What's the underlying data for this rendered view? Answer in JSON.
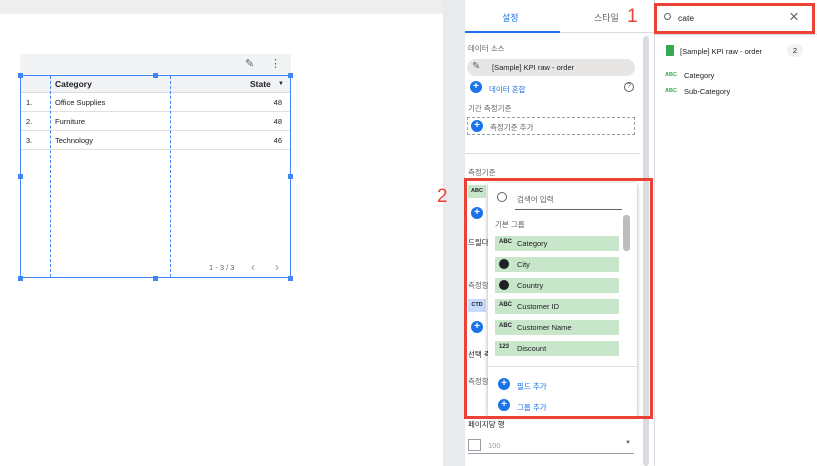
{
  "table": {
    "headers": [
      "Category",
      "State"
    ],
    "sort_indicator": "▼",
    "rows": [
      {
        "num": "1.",
        "category": "Office Supplies",
        "state": "48"
      },
      {
        "num": "2.",
        "category": "Furniture",
        "state": "48"
      },
      {
        "num": "3.",
        "category": "Technology",
        "state": "46"
      }
    ],
    "pagination": "1 - 3 / 3",
    "accent_color": "#4285f4"
  },
  "props": {
    "tab_setup": "설정",
    "tab_style": "스타일",
    "data_source_label": "데이터 소스",
    "data_source_name": "[Sample] KPI raw - order",
    "blend_data": "데이터 혼합",
    "date_range_label": "기간 측정기준",
    "add_dimension": "측정기준 추가",
    "dimension_label": "측정기준",
    "dimension_chip": "ABC",
    "drilldown_partial": "드릴다",
    "metric_label_partial": "측정항",
    "metric_chip": "CTD",
    "optional_partial": "선택 측",
    "metric2_partial": "측정항",
    "rows_per_page_label": "페이지당 행",
    "rows_per_page_value": "100",
    "accent_color": "#1a73e8"
  },
  "popup": {
    "search_placeholder": "검색어 입력",
    "group_label": "기본 그룹",
    "fields": [
      {
        "type": "ABC",
        "icon": "",
        "name": "Category"
      },
      {
        "type": "",
        "icon": "globe-icon",
        "name": "City"
      },
      {
        "type": "",
        "icon": "globe-icon",
        "name": "Country"
      },
      {
        "type": "ABC",
        "icon": "",
        "name": "Customer ID"
      },
      {
        "type": "ABC",
        "icon": "",
        "name": "Customer Name"
      },
      {
        "type": "123",
        "icon": "",
        "name": "Discount"
      }
    ],
    "add_field": "필드 추가",
    "add_group": "그룹 추가",
    "field_color": "#c8e6c9"
  },
  "search_panel": {
    "query": "cate",
    "source_name": "[Sample] KPI raw - order",
    "count": "2",
    "results": [
      {
        "type": "ABC",
        "name": "Category"
      },
      {
        "type": "ABC",
        "name": "Sub-Category"
      }
    ]
  },
  "annotations": {
    "label_1": "1",
    "label_2": "2",
    "color": "#ea4335"
  }
}
